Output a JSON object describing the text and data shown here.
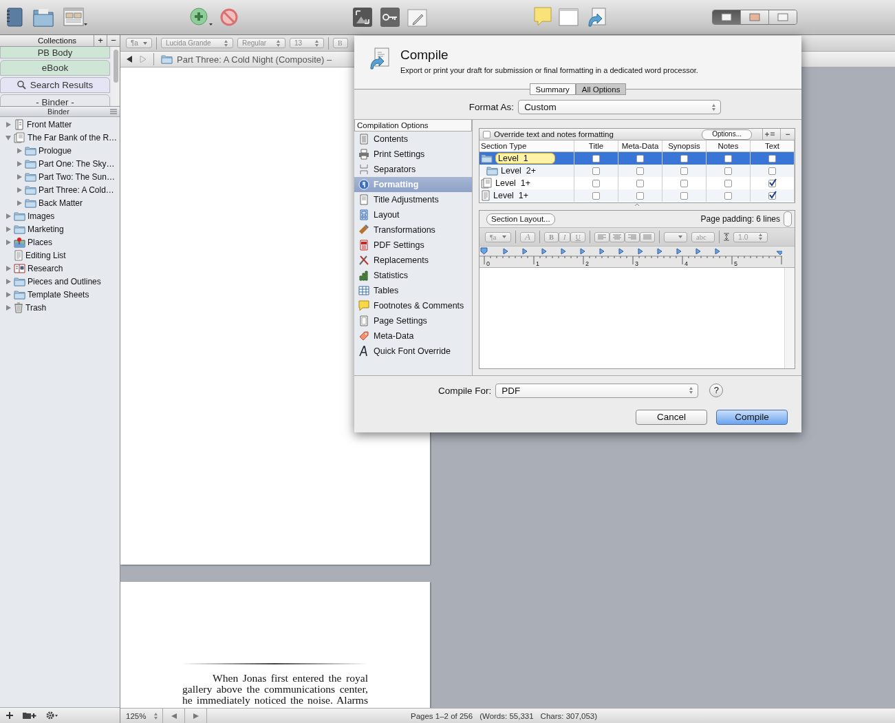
{
  "toolbar": {
    "view_modes": [
      {
        "selected": true
      },
      {
        "selected": false
      },
      {
        "selected": false
      }
    ]
  },
  "sidebar": {
    "collections_title": "Collections",
    "add": "+",
    "remove": "−",
    "collections": [
      {
        "label": "PB Body",
        "color": "#cfe6d6",
        "kind": "plain"
      },
      {
        "label": "eBook",
        "color": "#cfe6d6",
        "kind": "plain"
      },
      {
        "label": "Search Results",
        "color": "#e4e4f4",
        "kind": "search"
      },
      {
        "label": "- Binder -",
        "color": "#e6e8ec",
        "kind": "plain"
      }
    ],
    "binder_title": "Binder",
    "binder": [
      {
        "label": "Front Matter",
        "kind": "frontmatter",
        "expanded": false
      },
      {
        "label": "The Far Bank of the R…",
        "kind": "draft",
        "expanded": true,
        "children": [
          {
            "label": "Prologue",
            "kind": "folder",
            "expanded": false
          },
          {
            "label": "Part One: The Sky…",
            "kind": "folder",
            "expanded": false
          },
          {
            "label": "Part Two: The Sun…",
            "kind": "folder",
            "expanded": false
          },
          {
            "label": "Part Three: A Cold…",
            "kind": "folder",
            "expanded": false
          },
          {
            "label": "Back Matter",
            "kind": "folder",
            "expanded": false
          }
        ]
      },
      {
        "label": "Images",
        "kind": "folder",
        "expanded": false
      },
      {
        "label": "Marketing",
        "kind": "folder",
        "expanded": false
      },
      {
        "label": "Places",
        "kind": "places",
        "expanded": false
      },
      {
        "label": "Editing List",
        "kind": "list"
      },
      {
        "label": "Research",
        "kind": "research",
        "expanded": false
      },
      {
        "label": "Pieces and Outlines",
        "kind": "folder",
        "expanded": false
      },
      {
        "label": "Template Sheets",
        "kind": "folder",
        "expanded": false
      },
      {
        "label": "Trash",
        "kind": "trash",
        "expanded": false
      }
    ]
  },
  "format_bar": {
    "disabled": true,
    "paragraph_style": "¶a",
    "font": "Lucida Grande",
    "typeface": "Regular",
    "size": "13",
    "bold": "B"
  },
  "header_bar": {
    "title": "Part Three: A Cold Night (Composite) –"
  },
  "document": {
    "body": "When Jonas first entered the royal gallery above the communications center, he immediately noticed the noise. Alarms"
  },
  "status_bar": {
    "zoom": "125%",
    "pages": "Pages 1–2 of 256",
    "words": "(Words: 55,331",
    "chars": "Chars: 307,053)"
  },
  "dialog": {
    "title": "Compile",
    "description": "Export or print your draft for submission or final formatting in a dedicated word processor.",
    "tabs": [
      {
        "label": "Summary",
        "selected": false
      },
      {
        "label": "All Options",
        "selected": true
      }
    ],
    "format_as": {
      "label": "Format As:",
      "value": "Custom"
    },
    "options_title": "Compilation Options",
    "options": [
      {
        "label": "Contents",
        "kind": "list",
        "selected": false
      },
      {
        "label": "Print Settings",
        "kind": "printer",
        "selected": false
      },
      {
        "label": "Separators",
        "kind": "separator",
        "selected": false
      },
      {
        "label": "Formatting",
        "kind": "paragraph",
        "selected": true
      },
      {
        "label": "Title Adjustments",
        "kind": "document",
        "selected": false
      },
      {
        "label": "Layout",
        "kind": "layout",
        "selected": false
      },
      {
        "label": "Transformations",
        "kind": "brush",
        "selected": false
      },
      {
        "label": "PDF Settings",
        "kind": "pdf",
        "selected": false
      },
      {
        "label": "Replacements",
        "kind": "tools",
        "selected": false
      },
      {
        "label": "Statistics",
        "kind": "chart",
        "selected": false
      },
      {
        "label": "Tables",
        "kind": "table",
        "selected": false
      },
      {
        "label": "Footnotes & Comments",
        "kind": "note",
        "selected": false
      },
      {
        "label": "Page Settings",
        "kind": "page",
        "selected": false
      },
      {
        "label": "Meta-Data",
        "kind": "tag",
        "selected": false
      },
      {
        "label": "Quick Font Override",
        "kind": "font",
        "selected": false
      }
    ],
    "override": {
      "label": "Override text and notes formatting",
      "checked": false
    },
    "options_button": "Options...",
    "remove_button": "−",
    "columns": [
      "Section Type",
      "Title",
      "Meta-Data",
      "Synopsis",
      "Notes",
      "Text"
    ],
    "sections": [
      {
        "label": "Level  1",
        "kind": "folder",
        "selected": true,
        "editing": true,
        "checks": [
          false,
          false,
          false,
          false,
          false
        ],
        "children": [
          {
            "label": "Level  2+",
            "kind": "folder",
            "selected": false,
            "editing": false,
            "checks": [
              false,
              false,
              false,
              false,
              false
            ]
          }
        ]
      },
      {
        "label": "Level  1+",
        "kind": "documents",
        "selected": false,
        "editing": false,
        "checks": [
          false,
          false,
          false,
          false,
          true
        ]
      },
      {
        "label": "Level  1+",
        "kind": "document",
        "selected": false,
        "editing": false,
        "checks": [
          false,
          false,
          false,
          false,
          true
        ]
      }
    ],
    "section_layout_button": "Section Layout...",
    "page_padding": "Page padding: 6 lines",
    "format_toolbar": {
      "disabled": true,
      "paragraph_style": "¶a",
      "font_style": "A",
      "bold": "B",
      "italic": "I",
      "underline": "U",
      "highlight": "abc",
      "line_spacing": "1.0"
    },
    "ruler": [
      "0",
      "1",
      "2",
      "3",
      "4",
      "5"
    ],
    "compile_for": {
      "label": "Compile For:",
      "value": "PDF"
    },
    "help": "?",
    "cancel": "Cancel",
    "compile": "Compile"
  }
}
